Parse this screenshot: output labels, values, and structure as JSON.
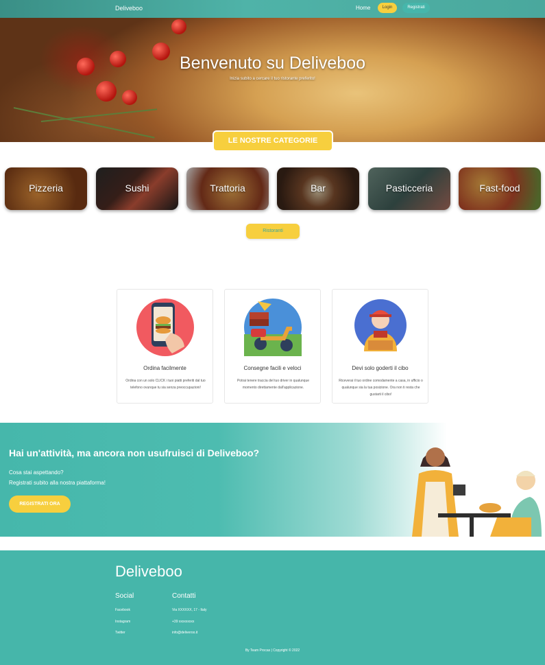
{
  "nav": {
    "brand": "Deliveboo",
    "home": "Home",
    "login": "Login",
    "register": "Registrati"
  },
  "hero": {
    "title": "Benvenuto su Deliveboo",
    "subtitle": "Inizia subito a cercare il tuo ristorante preferito!"
  },
  "categories": {
    "title": "LE NOSTRE CATEGORIE",
    "items": [
      {
        "label": "Pizzeria"
      },
      {
        "label": "Sushi"
      },
      {
        "label": "Trattoria"
      },
      {
        "label": "Bar"
      },
      {
        "label": "Pasticceria"
      },
      {
        "label": "Fast-food"
      }
    ],
    "restaurants_button": "Ristoranti"
  },
  "features": [
    {
      "title": "Ordina facilmente",
      "text": "Ordina con un solo CLICK i tuoi piatti preferiti dal tuo telefono ovunque tu sia senza preoccupazioni!",
      "icon": "phone-burger-icon"
    },
    {
      "title": "Consegne facili e veloci",
      "text": "Potrai tenere traccia del tuo driver in qualunque momento direttamente dall'applicazione.",
      "icon": "delivery-scooter-icon"
    },
    {
      "title": "Devi solo goderti il cibo",
      "text": "Riceverai il tuo ordine comodamente a casa, in ufficio o qualunque sia la tua posizione. Ora non ti resta che gustarti il cibo!",
      "icon": "delivery-person-icon"
    }
  ],
  "cta": {
    "title": "Hai un'attività, ma ancora non usufruisci di Deliveboo?",
    "line1": "Cosa stai aspettando?",
    "line2": "Registrati subito alla nostra piattaforma!",
    "button": "REGISTRATI ORA"
  },
  "footer": {
    "brand": "Deliveboo",
    "social": {
      "title": "Social",
      "links": [
        "Facebook",
        "Instagram",
        "Twitter"
      ]
    },
    "contacts": {
      "title": "Contatti",
      "items": [
        "Via XXXXXX, 17 - Italy",
        "+39 xxxxxxxxx",
        "info@deliveroo.it"
      ]
    },
    "copyright": "By Team Procas | Copyright © 2022"
  },
  "colors": {
    "accent_yellow": "#f7cf3e",
    "teal": "#46b6aa"
  }
}
